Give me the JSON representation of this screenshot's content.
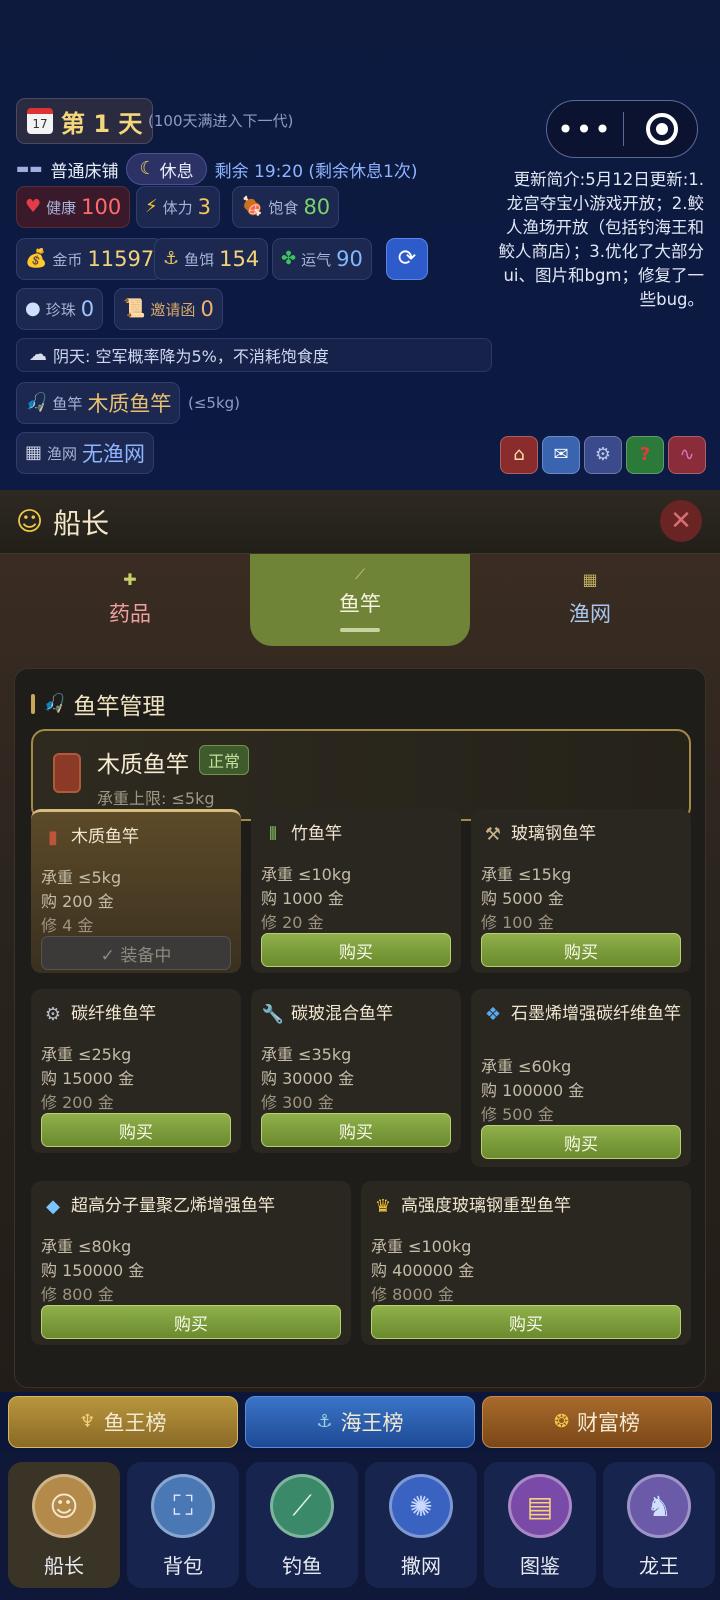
{
  "status": {
    "day_label": "第 1 天",
    "day_hint": "(100天满进入下一代)",
    "bed": "普通床铺",
    "rest_label": "休息",
    "rest_time": "剩余 19:20 (剩余休息1次)",
    "health_label": "健康",
    "health_value": "100",
    "stamina_label": "体力",
    "stamina_value": "3",
    "food_label": "饱食",
    "food_value": "80",
    "gold_label": "金币",
    "gold_value": "11597",
    "bait_label": "鱼饵",
    "bait_value": "154",
    "luck_label": "运气",
    "luck_value": "90",
    "pearl_label": "珍珠",
    "pearl_value": "0",
    "invite_label": "邀请函",
    "invite_value": "0",
    "weather": "阴天: 空军概率降为5%，不消耗饱食度",
    "rod_label": "鱼竿",
    "rod_value": "木质鱼竿",
    "rod_limit": "(≤5kg)",
    "net_label": "渔网",
    "net_value": "无渔网"
  },
  "notice": "更新简介:5月12日更新:1.龙宫夺宝小游戏开放；2.鲛人渔场开放（包括钓海王和鲛人商店）；3.优化了大部分ui、图片和bgm；修复了一些bug。",
  "capsule": {
    "more_icon": "more-dots-icon",
    "close_icon": "target-ring-icon"
  },
  "header": {
    "title": "船长"
  },
  "tabs": [
    {
      "label": "药品"
    },
    {
      "label": "鱼竿"
    },
    {
      "label": "渔网"
    }
  ],
  "panel": {
    "title": "鱼竿管理",
    "current_name": "木质鱼竿",
    "current_status": "正常",
    "current_limit": "承重上限: ≤5kg"
  },
  "rods": [
    {
      "name": "木质鱼竿",
      "load": "承重 ≤5kg",
      "buy": "购 200 金",
      "repair": "修 4 金",
      "action": "✓ 装备中",
      "icon": "wood-log-icon"
    },
    {
      "name": "竹鱼竿",
      "load": "承重 ≤10kg",
      "buy": "购 1000 金",
      "repair": "修 20 金",
      "action": "购买",
      "icon": "bamboo-icon"
    },
    {
      "name": "玻璃钢鱼竿",
      "load": "承重 ≤15kg",
      "buy": "购 5000 金",
      "repair": "修 100 金",
      "action": "购买",
      "icon": "hammer-icon"
    },
    {
      "name": "碳纤维鱼竿",
      "load": "承重 ≤25kg",
      "buy": "购 15000 金",
      "repair": "修 200 金",
      "action": "购买",
      "icon": "gear-icon"
    },
    {
      "name": "碳玻混合鱼竿",
      "load": "承重 ≤35kg",
      "buy": "购 30000 金",
      "repair": "修 300 金",
      "action": "购买",
      "icon": "wrench-icon"
    },
    {
      "name": "石墨烯增强碳纤维鱼竿",
      "load": "承重 ≤60kg",
      "buy": "购 100000 金",
      "repair": "修 500 金",
      "action": "购买",
      "icon": "diamond-tiles-icon"
    },
    {
      "name": "超高分子量聚乙烯增强鱼竿",
      "load": "承重 ≤80kg",
      "buy": "购 150000 金",
      "repair": "修 800 金",
      "action": "购买",
      "icon": "gem-icon"
    },
    {
      "name": "高强度玻璃钢重型鱼竿",
      "load": "承重 ≤100kg",
      "buy": "购 400000 金",
      "repair": "修 8000 金",
      "action": "购买",
      "icon": "crown-icon"
    }
  ],
  "rankings": [
    {
      "label": "鱼王榜",
      "color": "#9a7a2c"
    },
    {
      "label": "海王榜",
      "color": "#2a5aa8"
    },
    {
      "label": "财富榜",
      "color": "#8a5524"
    }
  ],
  "nav": [
    {
      "label": "船长",
      "color": "#b38a4a"
    },
    {
      "label": "背包",
      "color": "#4a78b4"
    },
    {
      "label": "钓鱼",
      "color": "#3a8a6a"
    },
    {
      "label": "撒网",
      "color": "#3a62c0"
    },
    {
      "label": "图鉴",
      "color": "#7a4aa8"
    },
    {
      "label": "龙王",
      "color": "#6a5aa8"
    }
  ]
}
